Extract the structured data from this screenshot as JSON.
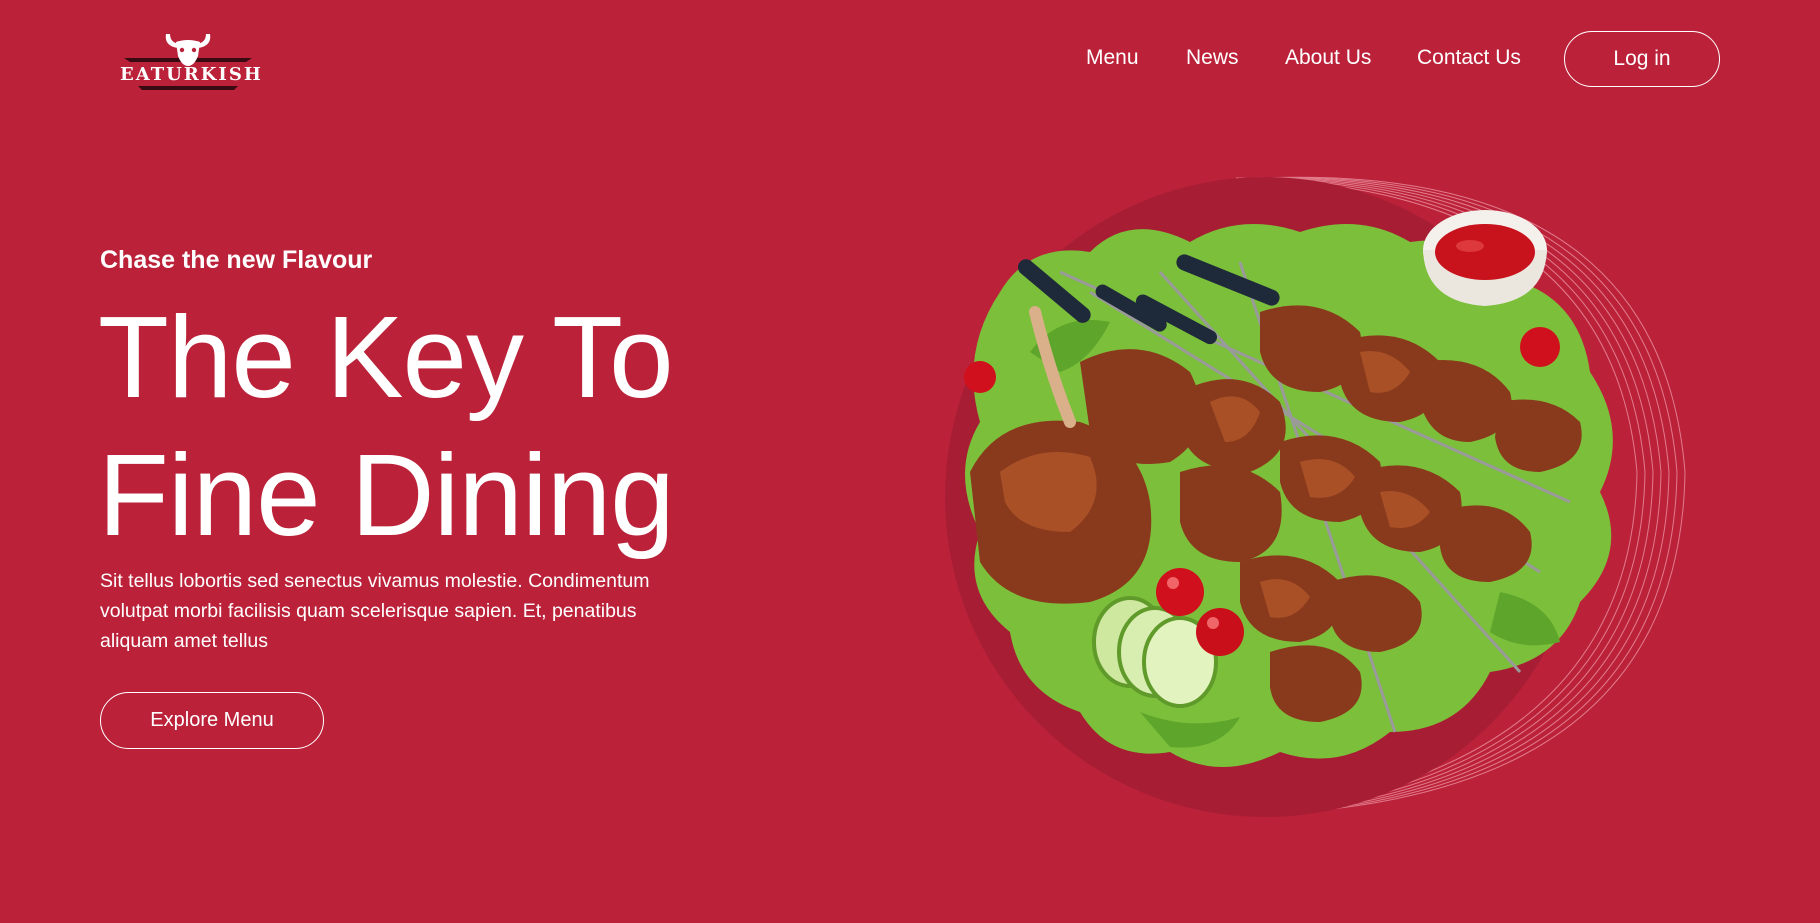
{
  "brand": {
    "logo_text": "EATURKISH",
    "icon": "bull-skull-icon"
  },
  "nav": {
    "items": [
      {
        "label": "Menu"
      },
      {
        "label": "News"
      },
      {
        "label": "About Us"
      },
      {
        "label": "Contact Us"
      }
    ],
    "login_label": "Log in"
  },
  "hero": {
    "eyebrow": "Chase the new Flavour",
    "headline_line1": "The Key To",
    "headline_line2": "Fine Dining",
    "description": "Sit tellus lobortis sed senectus vivamus molestie. Condimentum volutpat morbi facilisis quam scelerisque sapien. Et, penatibus aliquam amet tellus",
    "cta_label": "Explore Menu"
  },
  "colors": {
    "background": "#bb223a",
    "circle": "#a71e34",
    "text": "#ffffff"
  }
}
